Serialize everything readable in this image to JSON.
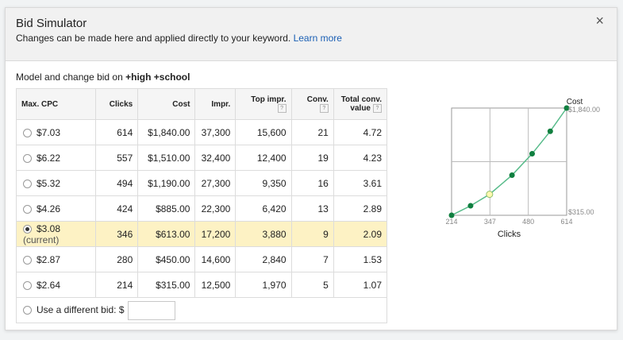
{
  "dialog": {
    "title": "Bid Simulator",
    "subtitle": "Changes can be made here and applied directly to your keyword.",
    "learn_more": "Learn more",
    "close": "×",
    "model_prefix": "Model and change bid on",
    "keyword": "+high +school"
  },
  "table": {
    "headers": {
      "max_cpc": "Max. CPC",
      "clicks": "Clicks",
      "cost": "Cost",
      "impr": "Impr.",
      "top_impr": "Top impr.",
      "conv": "Conv.",
      "total_conv_1": "Total conv.",
      "total_conv_2": "value",
      "help": "?"
    },
    "rows": [
      {
        "bid": "$7.03",
        "clicks": "614",
        "cost": "$1,840.00",
        "impr": "37,300",
        "top": "15,600",
        "conv": "21",
        "value": "4.72"
      },
      {
        "bid": "$6.22",
        "clicks": "557",
        "cost": "$1,510.00",
        "impr": "32,400",
        "top": "12,400",
        "conv": "19",
        "value": "4.23"
      },
      {
        "bid": "$5.32",
        "clicks": "494",
        "cost": "$1,190.00",
        "impr": "27,300",
        "top": "9,350",
        "conv": "16",
        "value": "3.61"
      },
      {
        "bid": "$4.26",
        "clicks": "424",
        "cost": "$885.00",
        "impr": "22,300",
        "top": "6,420",
        "conv": "13",
        "value": "2.89"
      },
      {
        "bid": "$3.08",
        "current": "(current)",
        "clicks": "346",
        "cost": "$613.00",
        "impr": "17,200",
        "top": "3,880",
        "conv": "9",
        "value": "2.09"
      },
      {
        "bid": "$2.87",
        "clicks": "280",
        "cost": "$450.00",
        "impr": "14,600",
        "top": "2,840",
        "conv": "7",
        "value": "1.53"
      },
      {
        "bid": "$2.64",
        "clicks": "214",
        "cost": "$315.00",
        "impr": "12,500",
        "top": "1,970",
        "conv": "5",
        "value": "1.07"
      }
    ],
    "different_bid": "Use a different bid: $"
  },
  "chart_data": {
    "type": "line",
    "ylabel": "Cost",
    "xlabel": "Clicks",
    "x_ticks": [
      "214",
      "347",
      "480",
      "614"
    ],
    "y_max_label": "$1,840.00",
    "y_min_label": "$315.00",
    "xlim": [
      214,
      614
    ],
    "ylim": [
      315,
      1840
    ],
    "points": [
      {
        "x": 214,
        "y": 315
      },
      {
        "x": 280,
        "y": 450
      },
      {
        "x": 346,
        "y": 613,
        "current": true
      },
      {
        "x": 424,
        "y": 885
      },
      {
        "x": 494,
        "y": 1190
      },
      {
        "x": 557,
        "y": 1510
      },
      {
        "x": 614,
        "y": 1840
      }
    ],
    "line_color": "#57bb8a",
    "point_color": "#0f7f3f",
    "current_point_color": "#fff9b0"
  }
}
